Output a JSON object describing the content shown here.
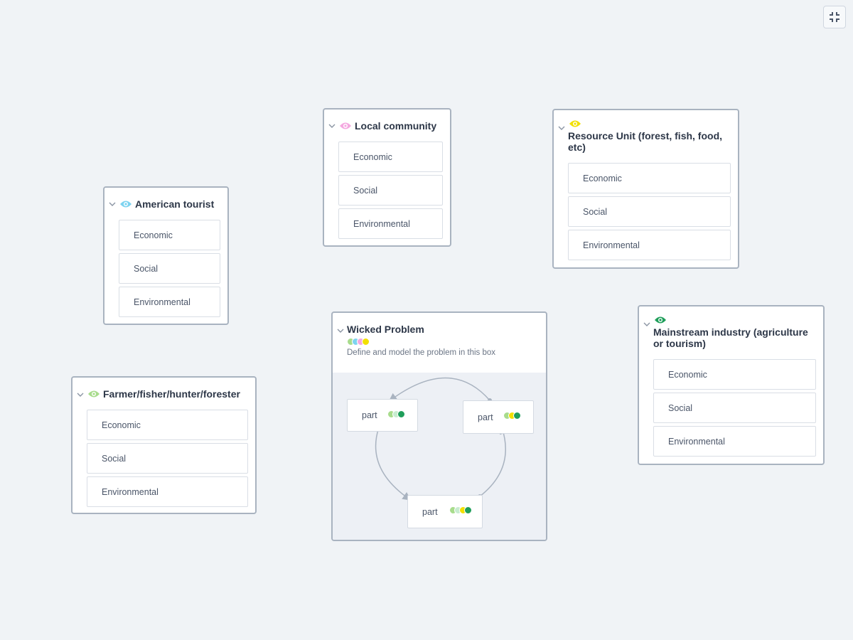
{
  "colors": {
    "american_tourist_eye": "#7dd3f0",
    "local_community_eye": "#f4a8e0",
    "resource_unit_eye": "#f2e000",
    "farmer_eye": "#a8dc8c",
    "mainstream_eye": "#1f9e5a"
  },
  "toolbar": {
    "exit_fullscreen_icon": "collapse-icon"
  },
  "cards": {
    "american_tourist": {
      "title": "American tourist",
      "rows": [
        "Economic",
        "Social",
        "Environmental"
      ]
    },
    "local_community": {
      "title": "Local community",
      "rows": [
        "Economic",
        "Social",
        "Environmental"
      ]
    },
    "resource_unit": {
      "title": "Resource Unit (forest, fish, food, etc)",
      "rows": [
        "Economic",
        "Social",
        "Environmental"
      ]
    },
    "farmer": {
      "title": "Farmer/fisher/hunter/forester",
      "rows": [
        "Economic",
        "Social",
        "Environmental"
      ]
    },
    "mainstream": {
      "title": "Mainstream industry (agriculture or tourism)",
      "rows": [
        "Economic",
        "Social",
        "Environmental"
      ]
    }
  },
  "wicked_problem": {
    "title": "Wicked Problem",
    "description": "Define and model the problem in this box",
    "parts": [
      {
        "label": "part"
      },
      {
        "label": "part"
      },
      {
        "label": "part"
      }
    ]
  }
}
